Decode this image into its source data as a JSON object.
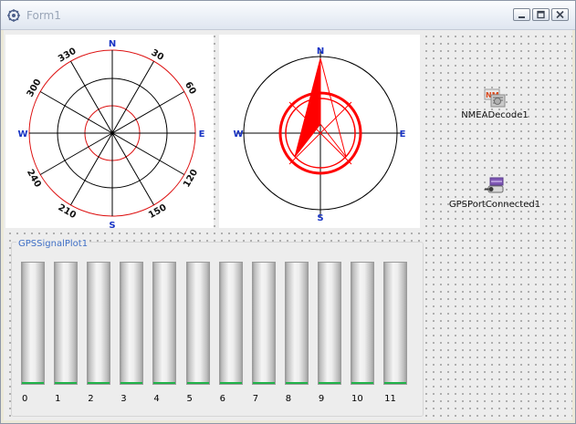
{
  "window": {
    "title": "Form1"
  },
  "sky_plot": {
    "cardinals": {
      "n": "N",
      "e": "E",
      "s": "S",
      "w": "W"
    },
    "degree_labels": [
      "30",
      "60",
      "120",
      "150",
      "210",
      "240",
      "300",
      "330"
    ]
  },
  "compass": {
    "cardinals": {
      "n": "N",
      "e": "E",
      "s": "S",
      "w": "W"
    },
    "needle_color": "#ff0000",
    "ring_color": "#ff0000"
  },
  "components": {
    "nmea": {
      "label": "NMEADecode1",
      "icon": "nmea-icon"
    },
    "gps_port": {
      "label": "GPSPortConnected1",
      "icon": "gps-port-icon"
    }
  },
  "signal_plot": {
    "title": "GPSSignalPlot1",
    "bar_color": "#21b34a",
    "bars": [
      {
        "label": "0",
        "level": 0.01
      },
      {
        "label": "1",
        "level": 0.01
      },
      {
        "label": "2",
        "level": 0.01
      },
      {
        "label": "3",
        "level": 0.01
      },
      {
        "label": "4",
        "level": 0.01
      },
      {
        "label": "5",
        "level": 0.01
      },
      {
        "label": "6",
        "level": 0.01
      },
      {
        "label": "7",
        "level": 0.01
      },
      {
        "label": "8",
        "level": 0.01
      },
      {
        "label": "9",
        "level": 0.01
      },
      {
        "label": "10",
        "level": 0.01
      },
      {
        "label": "11",
        "level": 0.01
      }
    ]
  }
}
